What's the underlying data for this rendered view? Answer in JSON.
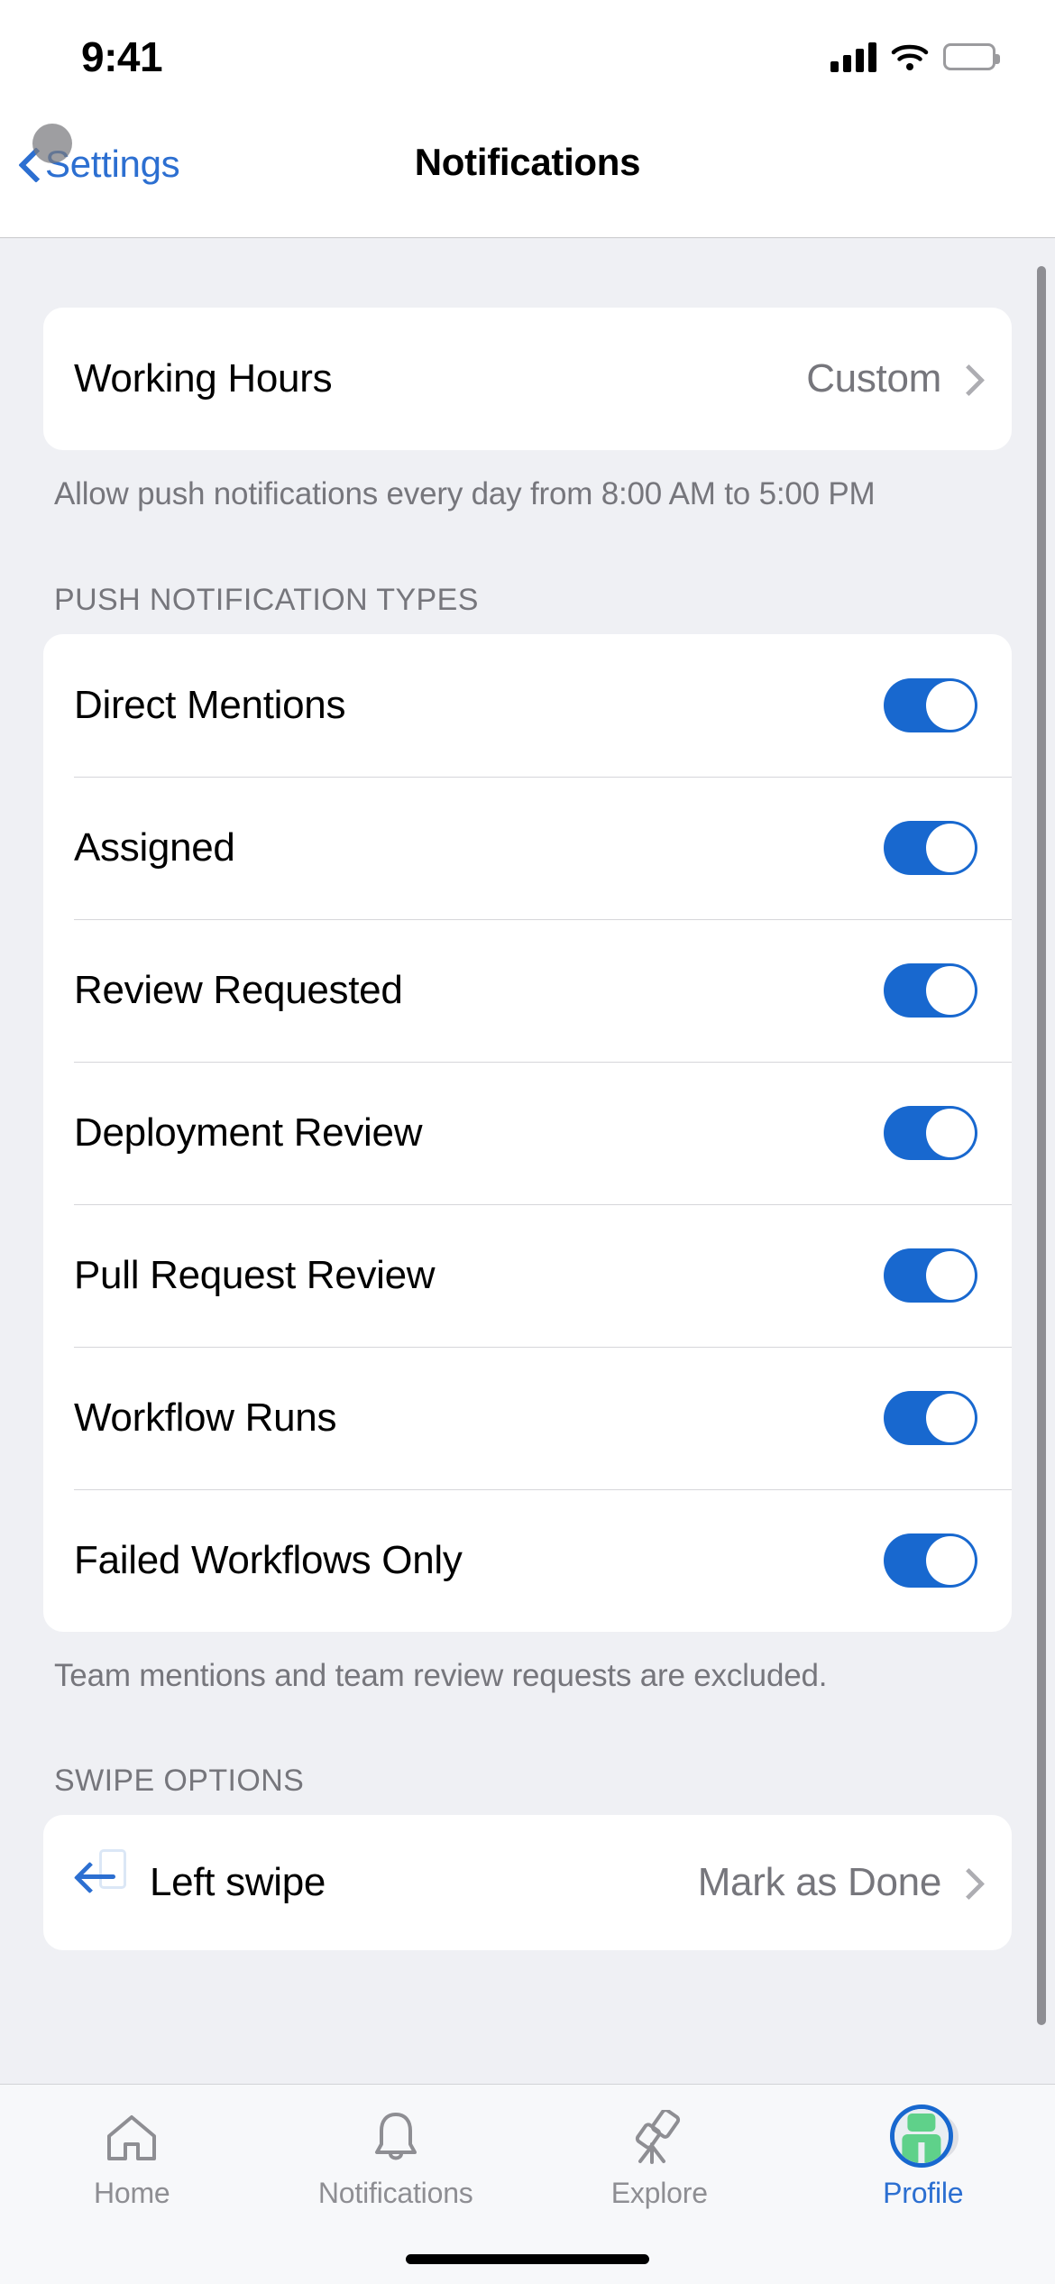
{
  "status_bar": {
    "time": "9:41",
    "cellular_icon": "cellular-bars-icon",
    "wifi_icon": "wifi-icon",
    "battery_icon": "battery-full-icon"
  },
  "nav": {
    "back_label": "Settings",
    "back_icon": "chevron-left-icon",
    "title": "Notifications"
  },
  "working_hours": {
    "label": "Working Hours",
    "value": "Custom",
    "chevron_icon": "chevron-right-icon",
    "footnote": "Allow push notifications every day from 8:00 AM to 5:00 PM"
  },
  "push_types": {
    "header": "PUSH NOTIFICATION TYPES",
    "footnote": "Team mentions and team review requests are excluded.",
    "rows": [
      {
        "label": "Direct Mentions",
        "state": "on"
      },
      {
        "label": "Assigned",
        "state": "on"
      },
      {
        "label": "Review Requested",
        "state": "on"
      },
      {
        "label": "Deployment Review",
        "state": "on"
      },
      {
        "label": "Pull Request Review",
        "state": "on"
      },
      {
        "label": "Workflow Runs",
        "state": "on"
      },
      {
        "label": "Failed Workflows Only",
        "state": "on"
      }
    ]
  },
  "swipe_options": {
    "header": "SWIPE OPTIONS",
    "rows": [
      {
        "icon": "arrow-left-swipe-icon",
        "label": "Left swipe",
        "value": "Mark as Done",
        "chevron_icon": "chevron-right-icon"
      }
    ]
  },
  "tabbar": {
    "tabs": [
      {
        "label": "Home",
        "icon": "home-icon",
        "active": false
      },
      {
        "label": "Notifications",
        "icon": "bell-icon",
        "active": false
      },
      {
        "label": "Explore",
        "icon": "telescope-icon",
        "active": false
      },
      {
        "label": "Profile",
        "icon": "avatar-icon",
        "active": true
      }
    ]
  },
  "colors": {
    "accent": "#1868cf",
    "link": "#2c6fd1",
    "page_background": "#eff0f4",
    "card_background": "#ffffff",
    "secondary_text": "#76767c"
  }
}
